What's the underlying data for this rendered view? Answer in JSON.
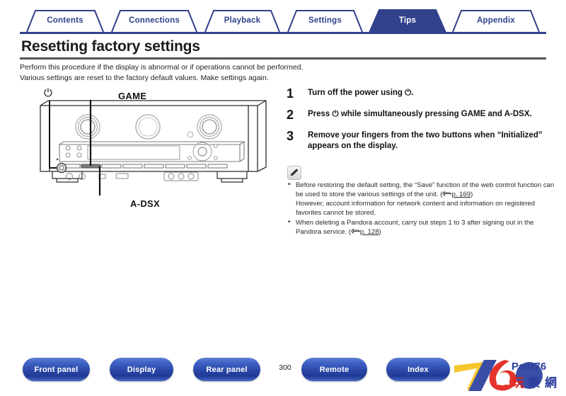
{
  "tabs": [
    {
      "label": "Contents",
      "active": false
    },
    {
      "label": "Connections",
      "active": false
    },
    {
      "label": "Playback",
      "active": false
    },
    {
      "label": "Settings",
      "active": false
    },
    {
      "label": "Tips",
      "active": true
    },
    {
      "label": "Appendix",
      "active": false
    }
  ],
  "page": {
    "title": "Resetting factory settings",
    "intro_line1": "Perform this procedure if the display is abnormal or if operations cannot be performed.",
    "intro_line2": "Various settings are reset to the factory default values. Make settings again."
  },
  "diagram": {
    "name": "av-receiver-front-panel",
    "power_symbol": "⏻",
    "labels": {
      "game": "GAME",
      "adsx": "A-DSX"
    }
  },
  "steps": [
    {
      "number": "1",
      "text": "Turn off the power using ⏻."
    },
    {
      "number": "2",
      "text": "Press ⏻ while simultaneously pressing GAME and A-DSX."
    },
    {
      "number": "3",
      "text": "Remove your fingers from the two buttons when “Initialized” appears on the display."
    }
  ],
  "note": {
    "icon": "pencil-icon",
    "items": [
      {
        "text_before": "Before restoring the default setting, the “Save” function of the web control function can be used to store the various settings of the unit.  (",
        "ref": "p. 169",
        "text_after": ")\nHowever, account information for network content and information on registered favorites cannot be stored."
      },
      {
        "text_before": "When deleting a Pandora account, carry out steps 1 to 3 after signing out in the Pandora service.  (",
        "ref": "p. 128",
        "text_after": ")"
      }
    ]
  },
  "bottom_nav": {
    "page_number": "300",
    "buttons": [
      {
        "label": "Front panel"
      },
      {
        "label": "Display"
      },
      {
        "label": "Rear panel"
      },
      {
        "label": "Remote"
      },
      {
        "label": "Index"
      }
    ]
  },
  "watermark": {
    "primary": "76",
    "secondary": "Post76",
    "tertiary": "玩樂網"
  },
  "colors": {
    "brand_blue": "#31418c",
    "tab_active_bg": "#31418c",
    "button_blue": "#2a47a8",
    "rule_gray": "#555555",
    "text_dark": "#111111"
  }
}
